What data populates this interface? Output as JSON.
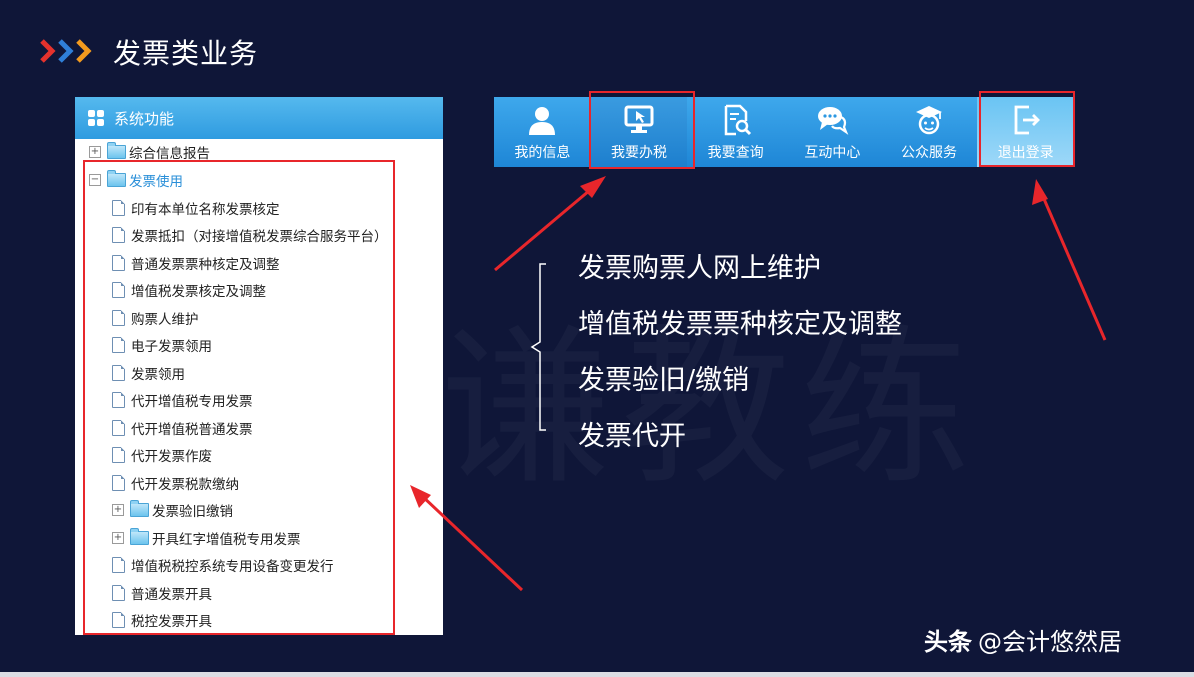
{
  "slide": {
    "title": "发票类业务",
    "credit_brand": "头条",
    "credit_handle": "@会计悠然居"
  },
  "colors": {
    "background": "#0f1638",
    "chevron_red": "#e5322d",
    "chevron_blue": "#2f7fd8",
    "chevron_orange": "#f39a1e",
    "toolbar_blue": "#2c98e2",
    "highlight_red": "#e8262b",
    "arrow_red": "#e8262b"
  },
  "tree": {
    "header": "系统功能",
    "header_icon": "grid-icon",
    "items": [
      {
        "label": "综合信息报告",
        "type": "folder",
        "expander": "+"
      },
      {
        "label": "发票使用",
        "type": "folder",
        "expander": "−",
        "highlight": true
      },
      {
        "label": "印有本单位名称发票核定",
        "type": "doc"
      },
      {
        "label": "发票抵扣（对接增值税发票综合服务平台）",
        "type": "doc"
      },
      {
        "label": "普通发票票种核定及调整",
        "type": "doc"
      },
      {
        "label": "增值税发票核定及调整",
        "type": "doc"
      },
      {
        "label": "购票人维护",
        "type": "doc"
      },
      {
        "label": "电子发票领用",
        "type": "doc"
      },
      {
        "label": "发票领用",
        "type": "doc"
      },
      {
        "label": "代开增值税专用发票",
        "type": "doc"
      },
      {
        "label": "代开增值税普通发票",
        "type": "doc"
      },
      {
        "label": "代开发票作废",
        "type": "doc"
      },
      {
        "label": "代开发票税款缴纳",
        "type": "doc"
      },
      {
        "label": "发票验旧缴销",
        "type": "folder",
        "expander": "+"
      },
      {
        "label": "开具红字增值税专用发票",
        "type": "folder",
        "expander": "+"
      },
      {
        "label": "增值税税控系统专用设备变更发行",
        "type": "doc"
      },
      {
        "label": "普通发票开具",
        "type": "doc"
      },
      {
        "label": "税控发票开具",
        "type": "doc"
      }
    ]
  },
  "toolbar": {
    "buttons": [
      {
        "label": "我的信息",
        "icon": "user-icon"
      },
      {
        "label": "我要办税",
        "icon": "monitor-cursor-icon",
        "highlight": true
      },
      {
        "label": "我要查询",
        "icon": "document-search-icon"
      },
      {
        "label": "互动中心",
        "icon": "chat-bubbles-icon"
      },
      {
        "label": "公众服务",
        "icon": "graduate-icon"
      },
      {
        "label": "退出登录",
        "icon": "logout-icon",
        "highlight": true
      }
    ]
  },
  "bullets": [
    "发票购票人网上维护",
    "增值税发票票种核定及调整",
    "发票验旧/缴销",
    "发票代开"
  ]
}
